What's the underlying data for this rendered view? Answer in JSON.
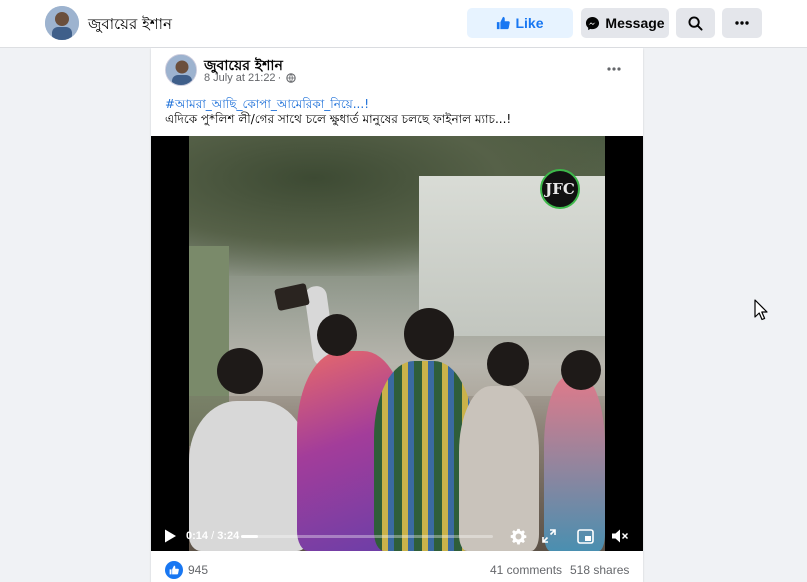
{
  "topbar": {
    "page_name": "জুবায়ের ইশান",
    "like_label": "Like",
    "message_label": "Message",
    "accent": "#1877f2"
  },
  "post": {
    "author": "জুবায়ের ইশান",
    "timestamp": "8 July at 21:22",
    "audience_icon": "globe-icon",
    "hashtag": "#আমরা_আছি_কোপা_আমেরিকা_নিয়ে...!",
    "text": "এদিকে পু*লিশ লী/গের সাথে চলে ক্ষুধার্ত মানুষের চলছে ফাইনাল ম্যাচ...!"
  },
  "video": {
    "watermark": "JFC",
    "current_time": "0:14",
    "separator": "/",
    "duration": "3:24",
    "progress_fraction": 0.0686
  },
  "engagement": {
    "reaction_icon": "like-reaction-icon",
    "reaction_count": "945",
    "comments": "41 comments",
    "shares": "518 shares"
  }
}
